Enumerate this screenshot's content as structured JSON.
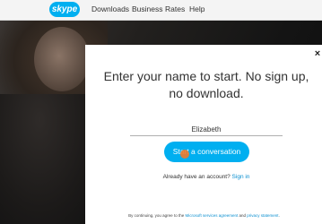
{
  "nav": {
    "logo_text": "skype",
    "items": [
      {
        "label": "Downloads"
      },
      {
        "label": "Business"
      },
      {
        "label": "Rates"
      },
      {
        "label": "Help"
      }
    ]
  },
  "modal": {
    "close_glyph": "×",
    "headline": "Enter your name to start. No sign up, no download.",
    "name_value": "Elizabeth",
    "start_button": "Start a conversation",
    "account_question": "Already have an account?",
    "sign_in_link": "Sign in",
    "footer_prefix": "By continuing, you agree to the",
    "footer_link1": "Microsoft services agreement",
    "footer_and": "and",
    "footer_link2": "privacy statement",
    "footer_suffix": "."
  },
  "colors": {
    "brand_blue": "#00aff0",
    "link_blue": "#0a8fd0",
    "cursor_orange": "#f07a2a"
  },
  "icons": {
    "close": "close-icon",
    "cursor": "cursor-indicator-icon"
  }
}
